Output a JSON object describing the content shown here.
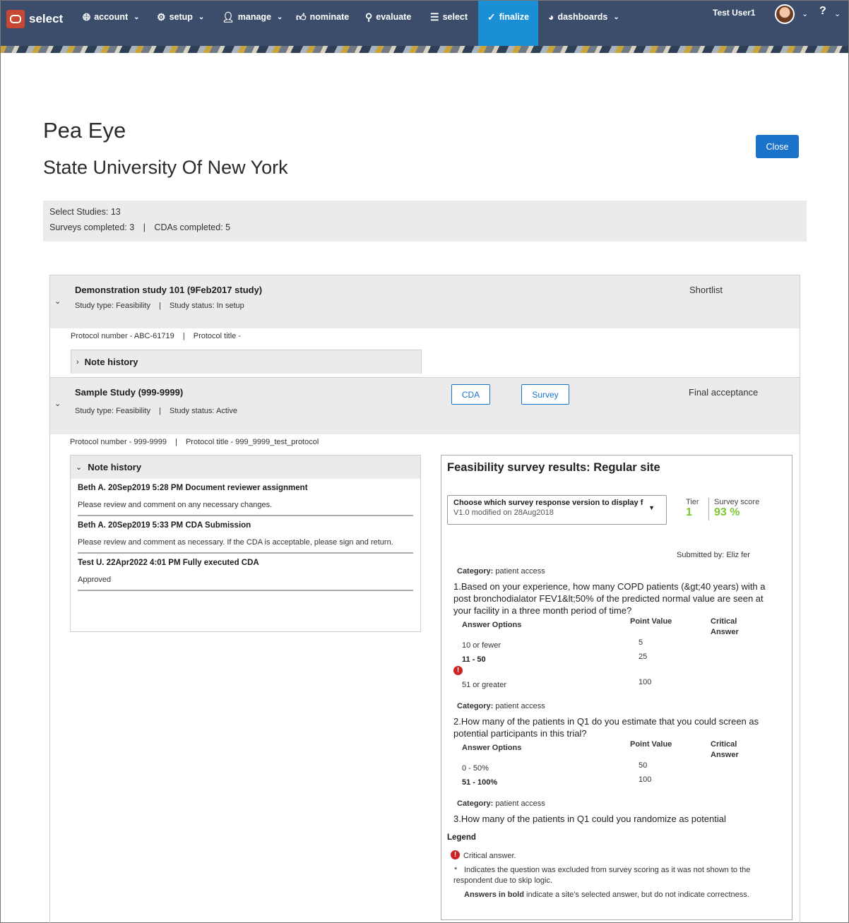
{
  "nav": {
    "brand": "select",
    "items": [
      {
        "label": "account",
        "icon": "globe-icon"
      },
      {
        "label": "setup",
        "icon": "gear-icon"
      },
      {
        "label": "manage",
        "icon": "person-icon"
      },
      {
        "label": "nominate",
        "icon": "thumbs-up-icon"
      },
      {
        "label": "evaluate",
        "icon": "search-icon"
      },
      {
        "label": "select",
        "icon": "list-icon"
      },
      {
        "label": "finalize",
        "icon": "check-circle-icon"
      },
      {
        "label": "dashboards",
        "icon": "pie-chart-icon"
      }
    ],
    "active": "finalize",
    "user": "Test User1",
    "help": "?"
  },
  "header": {
    "title": "Pea Eye",
    "subtitle": "State University Of New York",
    "close_label": "Close"
  },
  "summary": {
    "select_studies": "Select Studies: 13",
    "surveys_completed": "Surveys completed: 3",
    "cdas_completed": "CDAs completed: 5",
    "separator": "|"
  },
  "study1": {
    "title": "Demonstration study 101 (9Feb2017 study)",
    "study_type": "Study type: Feasibility",
    "study_status": "Study status: In setup",
    "status": "Shortlist",
    "protocol_number": "Protocol number - ABC-61719",
    "protocol_title": "Protocol title -",
    "note_history": "Note history"
  },
  "study2": {
    "title": "Sample Study (999-9999)",
    "study_type": "Study type: Feasibility",
    "study_status": "Study status: Active",
    "status": "Final acceptance",
    "cda_label": "CDA",
    "survey_label": "Survey",
    "protocol_number": "Protocol number - 999-9999",
    "protocol_title": "Protocol title - 999_9999_test_protocol",
    "note_history": "Note history",
    "notes": [
      {
        "header": "Beth A.  20Sep2019  5:28 PM  Document reviewer assignment",
        "body": "Please review and comment on any necessary changes."
      },
      {
        "header": "Beth A.  20Sep2019  5:33 PM  CDA Submission",
        "body": "Please review and comment as necessary. If the CDA is acceptable, please sign and return."
      },
      {
        "header": "Test U.  22Apr2022  4:01 PM  Fully executed CDA",
        "body": "Approved"
      }
    ]
  },
  "survey": {
    "title": "Feasibility survey results: Regular site",
    "select_label": "Choose which survey response version to display f",
    "select_value": "V1.0 modified on 28Aug2018",
    "tier_label": "Tier",
    "tier_value": "1",
    "score_label": "Survey score",
    "score_value": "93 %",
    "submitted_by": "Submitted by: Eliz                  fer",
    "category_label": "Category:",
    "category_value": "patient access",
    "col_answer": "Answer Options",
    "col_point": "Point Value",
    "col_critical_1": "Critical",
    "col_critical_2": "Answer",
    "q1": {
      "text": "1.Based on your experience, how many COPD patients (&gt;40 years) with a post bronchodialator FEV1&lt;50% of the predicted normal value are seen at your facility in a three month period of time?",
      "options": [
        {
          "label": "10 or fewer",
          "points": "5"
        },
        {
          "label": "11 - 50",
          "points": "25"
        },
        {
          "label": "51 or greater",
          "points": "100"
        }
      ]
    },
    "q2": {
      "text": "2.How many of the patients in Q1 do you estimate that you could screen as potential participants in this trial?",
      "options": [
        {
          "label": "0 - 50%",
          "points": "50"
        },
        {
          "label": "51 - 100%",
          "points": "100"
        }
      ]
    },
    "q3": {
      "text": "3.How many of the patients in Q1 could you randomize as potential"
    },
    "legend": {
      "title": "Legend",
      "critical": "Critical answer.",
      "excluded_mark": "*",
      "excluded": "Indicates the question was excluded from survey scoring as it was not shown to the respondent due to skip logic.",
      "bold_label": "Answers in bold",
      "bold_text": " indicate a site's selected answer, but do not indicate correctness."
    }
  }
}
